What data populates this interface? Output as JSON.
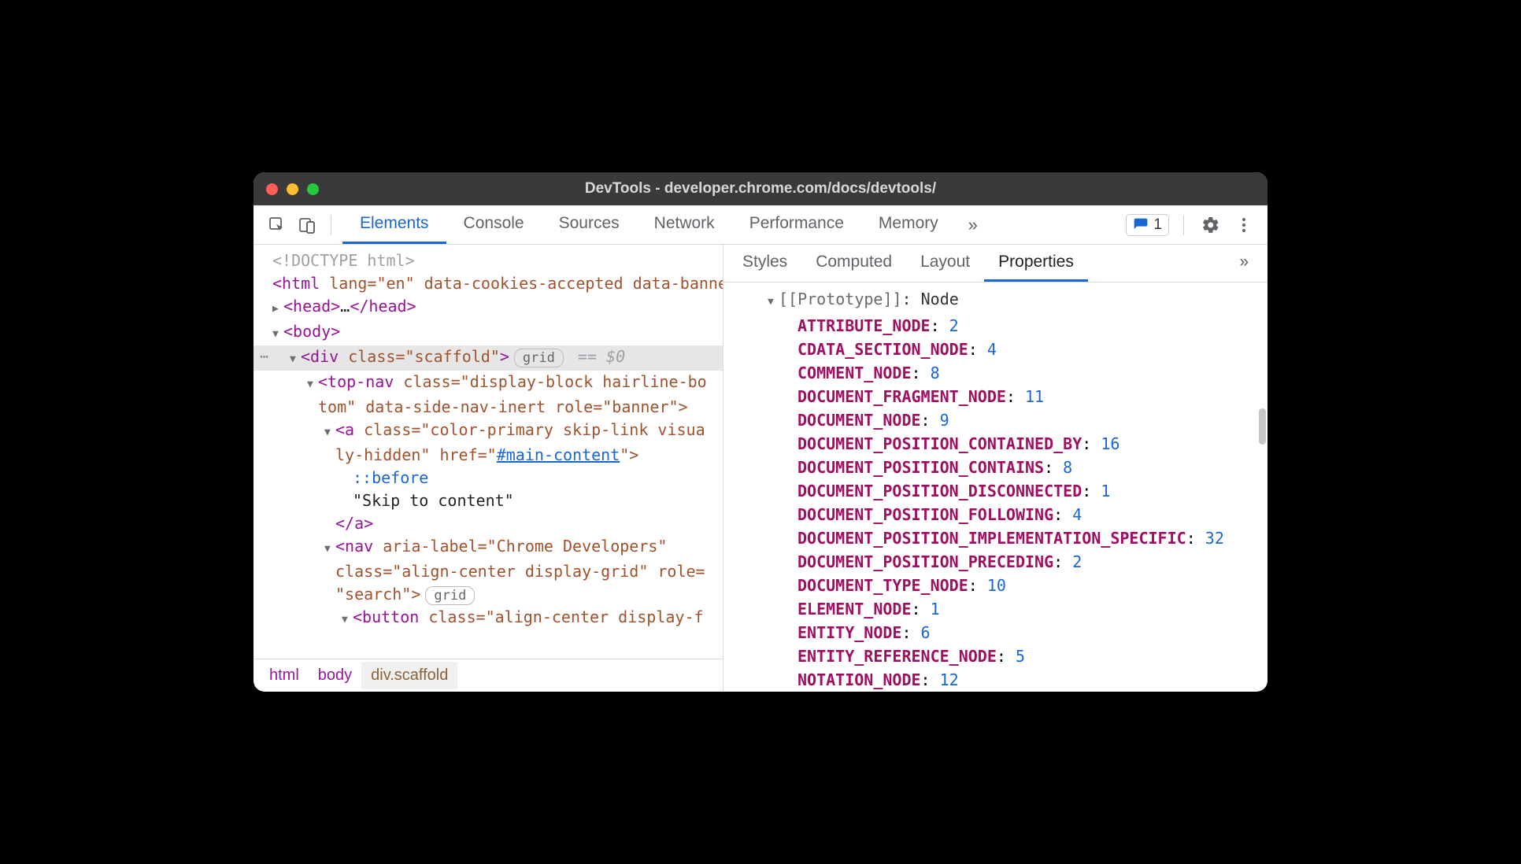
{
  "window": {
    "title": "DevTools - developer.chrome.com/docs/devtools/"
  },
  "toolbar": {
    "tabs": [
      "Elements",
      "Console",
      "Sources",
      "Network",
      "Performance",
      "Memory"
    ],
    "active_tab": "Elements",
    "issues_count": "1"
  },
  "dom": {
    "doctype": "<!DOCTYPE html>",
    "html_open_tag": "html",
    "html_attrs": " lang=\"en\" data-cookies-accepted data-banner-dismissed",
    "head_tag": "head",
    "head_ellipsis": "…",
    "body_tag": "body",
    "div_tag": "div",
    "div_attrs": " class=\"scaffold\"",
    "div_badge": "grid",
    "div_hint": "== $0",
    "topnav_tag": "top-nav",
    "topnav_attrs_l1": " class=\"display-block hairline-bo",
    "topnav_attrs_l2": "tom\" data-side-nav-inert role=\"banner\">",
    "a_tag": "a",
    "a_attrs_l1": " class=\"color-primary skip-link visua",
    "a_attrs_l2": "ly-hidden\" href=\"",
    "a_href": "#main-content",
    "a_close_angle": "\">",
    "a_pseudo": "::before",
    "a_text": "\"Skip to content\"",
    "a_close": "a",
    "nav_tag": "nav",
    "nav_attrs_l1": " aria-label=\"Chrome Developers\"",
    "nav_attrs_l2": "class=\"align-center display-grid\" role=",
    "nav_attrs_l3": "\"search\">",
    "nav_badge": "grid",
    "button_tag": "button",
    "button_attrs_l1": " class=\"align-center display-f"
  },
  "breadcrumb": {
    "items": [
      "html",
      "body",
      "div.scaffold"
    ],
    "active": "div.scaffold"
  },
  "side_tabs": {
    "tabs": [
      "Styles",
      "Computed",
      "Layout",
      "Properties"
    ],
    "active": "Properties"
  },
  "properties": {
    "prototype_label": "[[Prototype]]",
    "prototype_value": "Node",
    "entries": [
      {
        "key": "ATTRIBUTE_NODE",
        "value": "2"
      },
      {
        "key": "CDATA_SECTION_NODE",
        "value": "4"
      },
      {
        "key": "COMMENT_NODE",
        "value": "8"
      },
      {
        "key": "DOCUMENT_FRAGMENT_NODE",
        "value": "11"
      },
      {
        "key": "DOCUMENT_NODE",
        "value": "9"
      },
      {
        "key": "DOCUMENT_POSITION_CONTAINED_BY",
        "value": "16"
      },
      {
        "key": "DOCUMENT_POSITION_CONTAINS",
        "value": "8"
      },
      {
        "key": "DOCUMENT_POSITION_DISCONNECTED",
        "value": "1"
      },
      {
        "key": "DOCUMENT_POSITION_FOLLOWING",
        "value": "4"
      },
      {
        "key": "DOCUMENT_POSITION_IMPLEMENTATION_SPECIFIC",
        "value": "32"
      },
      {
        "key": "DOCUMENT_POSITION_PRECEDING",
        "value": "2"
      },
      {
        "key": "DOCUMENT_TYPE_NODE",
        "value": "10"
      },
      {
        "key": "ELEMENT_NODE",
        "value": "1"
      },
      {
        "key": "ENTITY_NODE",
        "value": "6"
      },
      {
        "key": "ENTITY_REFERENCE_NODE",
        "value": "5"
      },
      {
        "key": "NOTATION_NODE",
        "value": "12"
      }
    ]
  }
}
